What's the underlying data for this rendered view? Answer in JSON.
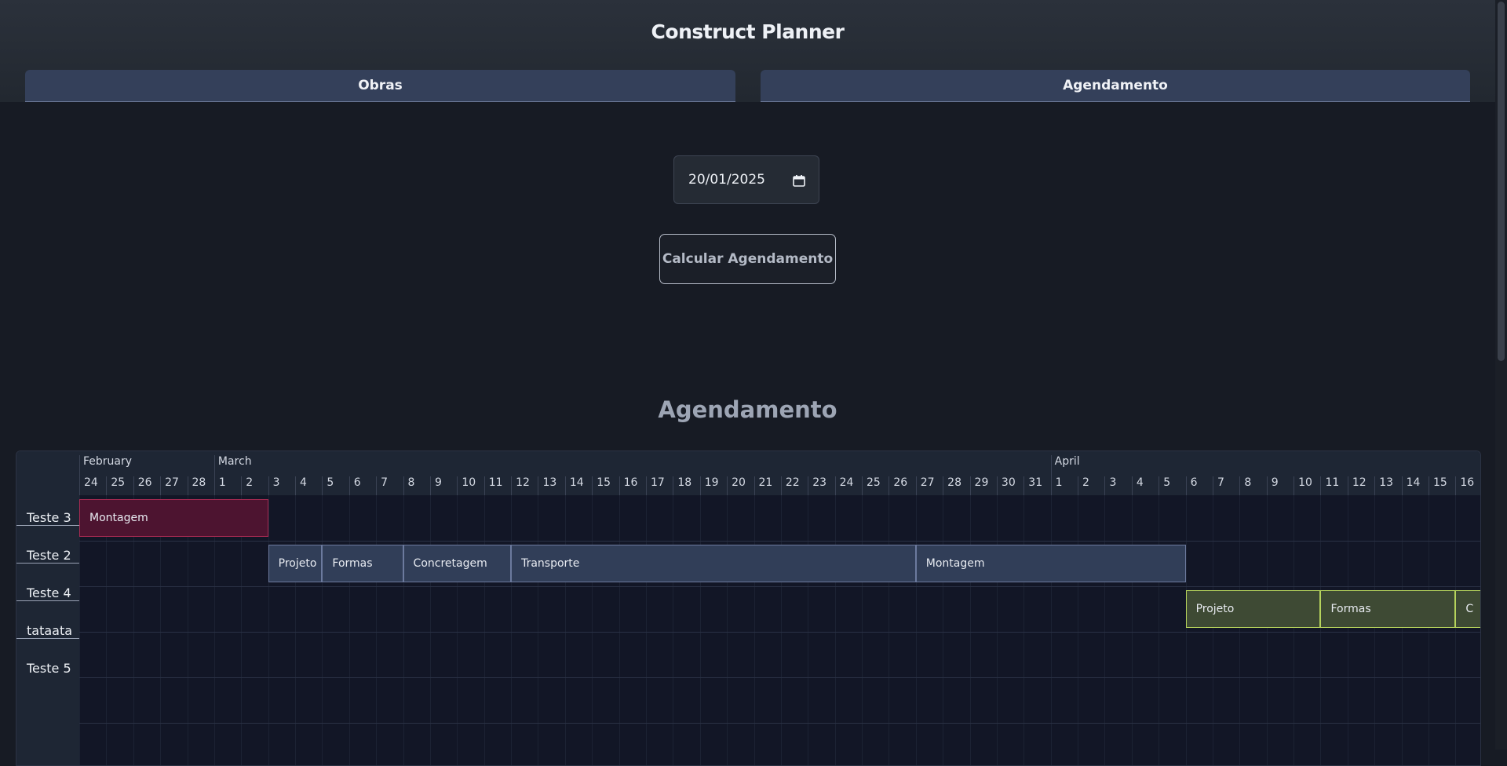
{
  "app": {
    "title": "Construct Planner"
  },
  "tabs": [
    {
      "label": "Obras"
    },
    {
      "label": "Agendamento"
    }
  ],
  "form": {
    "date_value": "20/01/2025",
    "calculate_label": "Calcular Agendamento"
  },
  "schedule": {
    "title": "Agendamento",
    "months": [
      "February",
      "March",
      "April"
    ],
    "days": [
      "24",
      "25",
      "26",
      "27",
      "28",
      "1",
      "2",
      "3",
      "4",
      "5",
      "6",
      "7",
      "8",
      "9",
      "10",
      "11",
      "12",
      "13",
      "14",
      "15",
      "16",
      "17",
      "18",
      "19",
      "20",
      "21",
      "22",
      "23",
      "24",
      "25",
      "26",
      "27",
      "28",
      "29",
      "30",
      "31",
      "1",
      "2",
      "3",
      "4",
      "5",
      "6",
      "7",
      "8",
      "9",
      "10",
      "11",
      "12",
      "13",
      "14",
      "15",
      "16"
    ],
    "rows": [
      "Teste 3",
      "Teste 2",
      "Teste 4",
      "tataata",
      "Teste 5"
    ],
    "tasks": [
      {
        "row": 0,
        "label": "Montagem",
        "start": "2025-02-24",
        "end": "2025-03-03",
        "color": "#4d1430"
      },
      {
        "row": 1,
        "label": "Projeto",
        "start": "2025-03-03",
        "end": "2025-03-05",
        "color": "#313e58"
      },
      {
        "row": 1,
        "label": "Formas",
        "start": "2025-03-05",
        "end": "2025-03-08",
        "color": "#313e58"
      },
      {
        "row": 1,
        "label": "Concretagem",
        "start": "2025-03-08",
        "end": "2025-03-12",
        "color": "#313e58"
      },
      {
        "row": 1,
        "label": "Transporte",
        "start": "2025-03-12",
        "end": "2025-03-27",
        "color": "#313e58"
      },
      {
        "row": 1,
        "label": "Montagem",
        "start": "2025-03-27",
        "end": "2025-04-06",
        "color": "#313e58"
      },
      {
        "row": 2,
        "label": "Projeto",
        "start": "2025-04-06",
        "end": "2025-04-11",
        "color": "#3e4a34"
      },
      {
        "row": 2,
        "label": "Formas",
        "start": "2025-04-11",
        "end": "2025-04-16",
        "color": "#3e4a34"
      },
      {
        "row": 2,
        "label": "C",
        "start": "2025-04-16",
        "end": "2025-04-20",
        "color": "#3e4a34"
      }
    ]
  }
}
